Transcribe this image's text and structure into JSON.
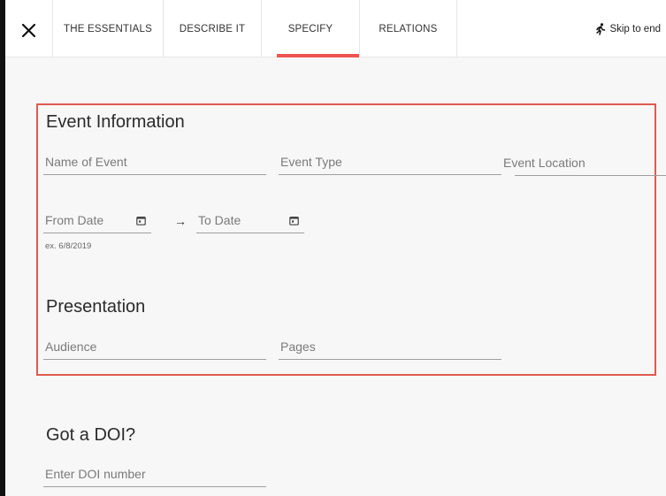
{
  "topbar": {
    "close_icon": "close-icon",
    "tabs": [
      {
        "label": "THE ESSENTIALS"
      },
      {
        "label": "DESCRIBE IT"
      },
      {
        "label": "SPECIFY",
        "active": true
      },
      {
        "label": "RELATIONS"
      }
    ],
    "active_accent": "#ef5350",
    "skip_label": "Skip to end",
    "skip_icon": "running-person-icon"
  },
  "event": {
    "title": "Event Information",
    "name_placeholder": "Name of Event",
    "type_placeholder": "Event Type",
    "location_placeholder": "Event Location",
    "from_placeholder": "From Date",
    "to_placeholder": "To Date",
    "date_hint": "ex. 6/8/2019",
    "arrow": "→"
  },
  "presentation": {
    "title": "Presentation",
    "audience_placeholder": "Audience",
    "pages_placeholder": "Pages"
  },
  "doi": {
    "title": "Got a DOI?",
    "placeholder": "Enter DOI number"
  },
  "highlight_color": "#e05a50"
}
